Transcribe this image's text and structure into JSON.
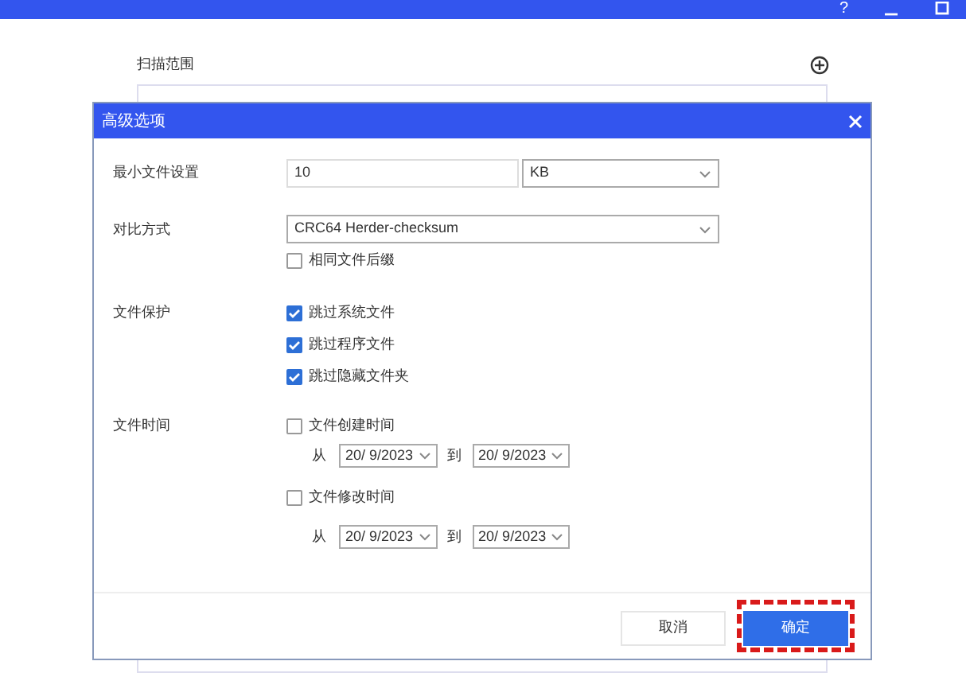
{
  "window": {
    "controls": [
      "?"
    ]
  },
  "scan_range": {
    "label": "扫描范围"
  },
  "dialog": {
    "title": "高级选项",
    "min_file": {
      "label": "最小文件设置",
      "value": "10",
      "unit": "KB"
    },
    "compare": {
      "label": "对比方式",
      "method": "CRC64 Herder-checksum",
      "options": [
        {
          "label": "相同文件后缀",
          "checked": false
        }
      ]
    },
    "protection": {
      "label": "文件保护",
      "options": [
        {
          "label": "跳过系统文件",
          "checked": true
        },
        {
          "label": "跳过程序文件",
          "checked": true
        },
        {
          "label": "跳过隐藏文件夹",
          "checked": true
        }
      ]
    },
    "time": {
      "label": "文件时间",
      "filters": [
        {
          "label": "文件创建时间",
          "checked": false,
          "from_label": "从",
          "from": "20/ 9/2023",
          "to_label": "到",
          "to": "20/ 9/2023"
        },
        {
          "label": "文件修改时间",
          "checked": false,
          "from_label": "从",
          "from": "20/ 9/2023",
          "to_label": "到",
          "to": "20/ 9/2023"
        }
      ]
    },
    "buttons": [
      {
        "label": "取消",
        "kind": "secondary",
        "highlighted": false
      },
      {
        "label": "确定",
        "kind": "primary",
        "highlighted": true
      }
    ]
  }
}
